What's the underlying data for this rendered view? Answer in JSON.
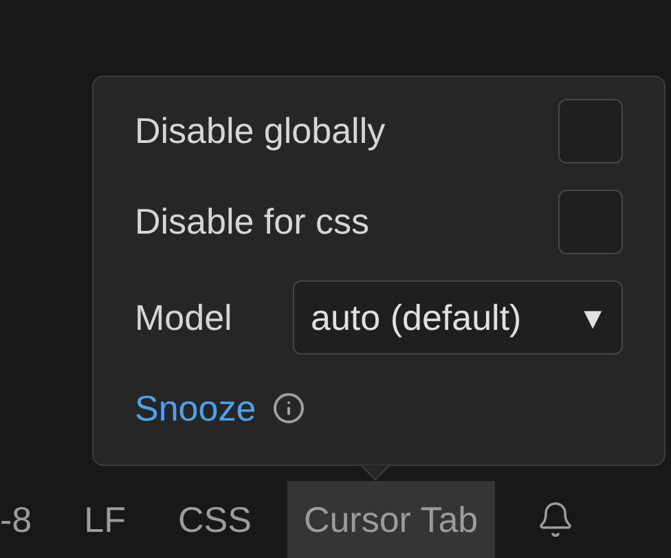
{
  "popup": {
    "options": [
      {
        "kind": "checkbox",
        "label": "Disable globally",
        "checked": false
      },
      {
        "kind": "checkbox",
        "label": "Disable for css",
        "checked": false
      },
      {
        "kind": "select",
        "label": "Model",
        "value": "auto (default)",
        "arrow": "▼"
      }
    ],
    "link": "Snooze"
  },
  "status_bar": [
    {
      "label": "-8",
      "selected": false
    },
    {
      "label": "LF",
      "selected": false
    },
    {
      "label": "CSS",
      "selected": false
    },
    {
      "label": "Cursor Tab",
      "selected": true
    }
  ]
}
